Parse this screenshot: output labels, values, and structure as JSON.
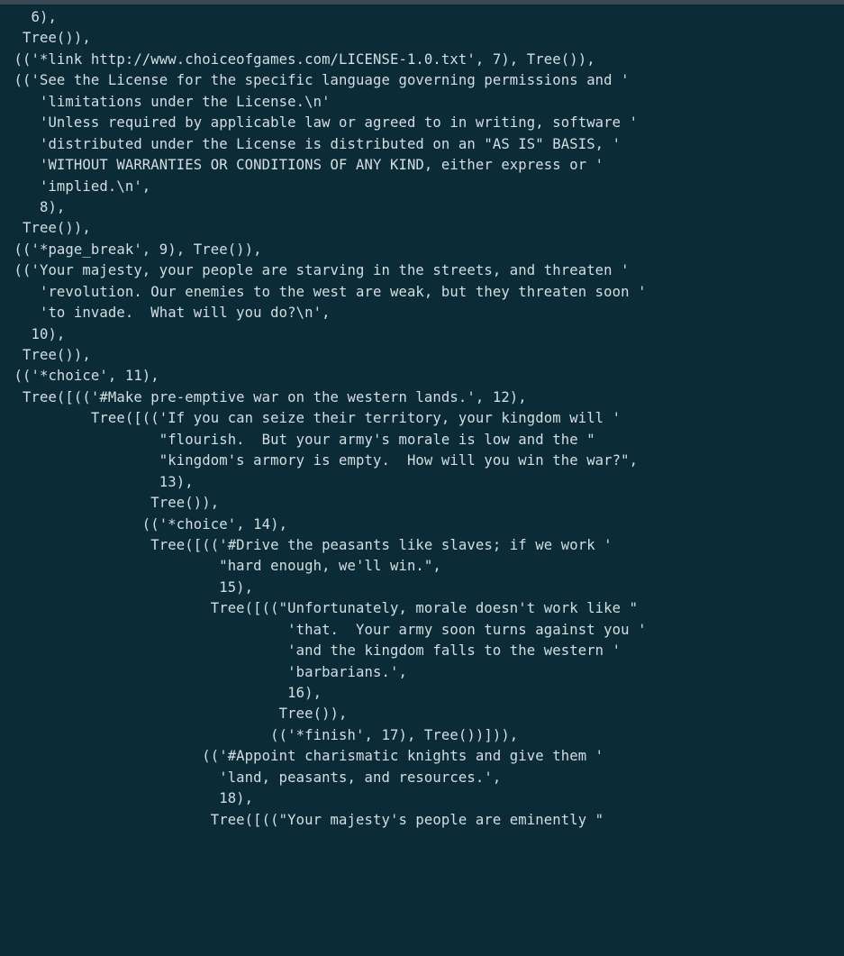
{
  "lines": [
    "   6),",
    "  Tree()),",
    " (('*link http://www.choiceofgames.com/LICENSE-1.0.txt', 7), Tree()),",
    " (('See the License for the specific language governing permissions and '",
    "    'limitations under the License.\\n'",
    "    'Unless required by applicable law or agreed to in writing, software '",
    "    'distributed under the License is distributed on an \"AS IS\" BASIS, '",
    "    'WITHOUT WARRANTIES OR CONDITIONS OF ANY KIND, either express or '",
    "    'implied.\\n',",
    "    8),",
    "  Tree()),",
    " (('*page_break', 9), Tree()),",
    " (('Your majesty, your people are starving in the streets, and threaten '",
    "    'revolution. Our enemies to the west are weak, but they threaten soon '",
    "    'to invade.  What will you do?\\n',",
    "   10),",
    "  Tree()),",
    " (('*choice', 11),",
    "  Tree([(('#Make pre-emptive war on the western lands.', 12),",
    "          Tree([(('If you can seize their territory, your kingdom will '",
    "                  \"flourish.  But your army's morale is low and the \"",
    "                  \"kingdom's armory is empty.  How will you win the war?\",",
    "                  13),",
    "                 Tree()),",
    "                (('*choice', 14),",
    "                 Tree([(('#Drive the peasants like slaves; if we work '",
    "                         \"hard enough, we'll win.\",",
    "                         15),",
    "                        Tree([((\"Unfortunately, morale doesn't work like \"",
    "                                 'that.  Your army soon turns against you '",
    "                                 'and the kingdom falls to the western '",
    "                                 'barbarians.',",
    "                                 16),",
    "                                Tree()),",
    "                               (('*finish', 17), Tree())])),",
    "                       (('#Appoint charismatic knights and give them '",
    "                         'land, peasants, and resources.',",
    "                         18),",
    "                        Tree([((\"Your majesty's people are eminently \""
  ]
}
